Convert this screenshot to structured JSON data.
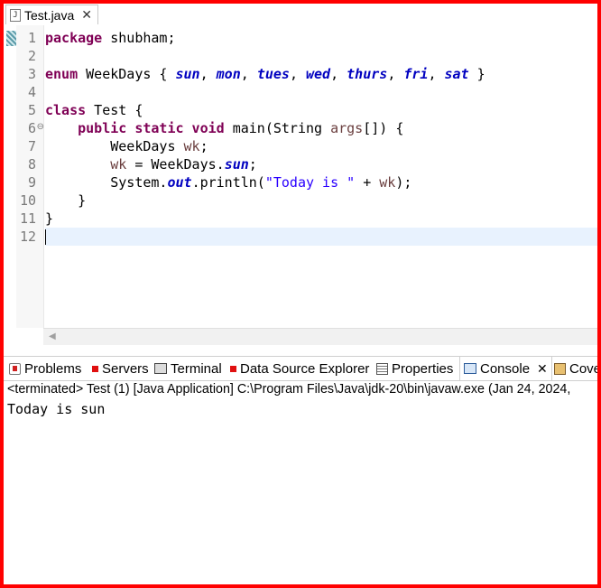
{
  "editor_tab": {
    "label": "Test.java",
    "close": "✕",
    "icon": "java-file-icon"
  },
  "code_lines": [
    {
      "n": "1"
    },
    {
      "n": "2"
    },
    {
      "n": "3"
    },
    {
      "n": "4"
    },
    {
      "n": "5"
    },
    {
      "n": "6"
    },
    {
      "n": "7"
    },
    {
      "n": "8"
    },
    {
      "n": "9"
    },
    {
      "n": "10"
    },
    {
      "n": "11"
    },
    {
      "n": "12"
    }
  ],
  "fold_marker": "⊖",
  "code": {
    "l1_kw": "package",
    "l1_rest": " shubham;",
    "l3_kw": "enum",
    "l3_name": " WeekDays { ",
    "l3_c1": "sun",
    "l3_s1": ", ",
    "l3_c2": "mon",
    "l3_s2": ", ",
    "l3_c3": "tues",
    "l3_s3": ", ",
    "l3_c4": "wed",
    "l3_s4": ", ",
    "l3_c5": "thurs",
    "l3_s5": ", ",
    "l3_c6": "fri",
    "l3_s6": ", ",
    "l3_c7": "sat",
    "l3_end": " }",
    "l5_kw": "class",
    "l5_rest": " Test {",
    "l6_indent": "    ",
    "l6_kw": "public static void",
    "l6_a": " main(String ",
    "l6_var": "args",
    "l6_b": "[]) {",
    "l7_indent": "        ",
    "l7_a": "WeekDays ",
    "l7_var": "wk",
    "l7_b": ";",
    "l8_indent": "        ",
    "l8_var": "wk",
    "l8_a": " = WeekDays.",
    "l8_fld": "sun",
    "l8_b": ";",
    "l9_indent": "        ",
    "l9_a": "System.",
    "l9_fld": "out",
    "l9_b": ".println(",
    "l9_str": "\"Today is \"",
    "l9_c": " + ",
    "l9_var": "wk",
    "l9_d": ");",
    "l10": "    }",
    "l11": "}"
  },
  "view_tabs": {
    "problems": "Problems",
    "servers": "Servers",
    "terminal": "Terminal",
    "dse": "Data Source Explorer",
    "properties": "Properties",
    "console": "Console",
    "console_close": "✕",
    "coverage": "Cove"
  },
  "console": {
    "description": "<terminated> Test (1) [Java Application] C:\\Program Files\\Java\\jdk-20\\bin\\javaw.exe  (Jan 24, 2024,",
    "output": "Today is sun"
  },
  "colors": {
    "frame_border": "#ff0000",
    "keyword": "#7f0055",
    "enum_constant": "#0000c0",
    "string": "#2a00ff",
    "current_line": "#e8f2fe"
  }
}
